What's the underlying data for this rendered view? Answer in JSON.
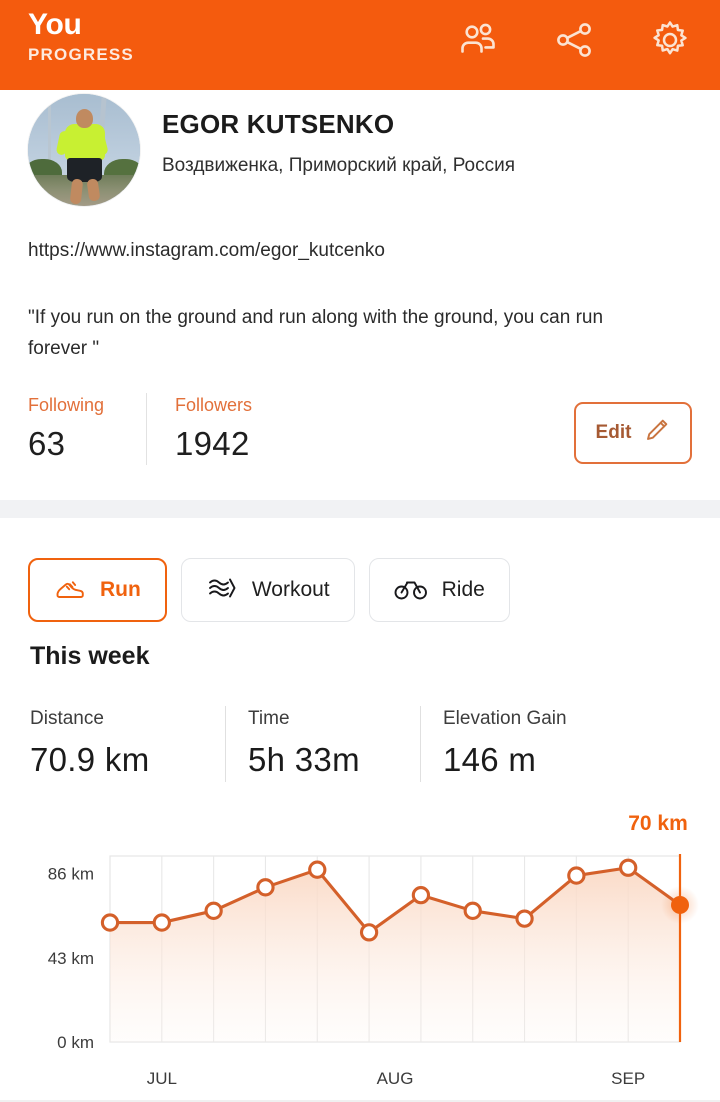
{
  "header": {
    "title": "You",
    "subtitle": "PROGRESS",
    "icons": [
      {
        "name": "friends-icon",
        "label": "Friends"
      },
      {
        "name": "share-icon",
        "label": "Share"
      },
      {
        "name": "settings-gear-icon",
        "label": "Settings"
      }
    ],
    "background_color": "#f45b0e"
  },
  "profile": {
    "avatar_alt": "runner-photo",
    "name": "EGOR KUTSENKO",
    "location": "Воздвиженка, Приморский край, Россия",
    "link": "https://www.instagram.com/egor_kutcenko",
    "bio": "\"If you run on the ground and run along with the ground, you can run forever \"",
    "following_label": "Following",
    "following_count": "63",
    "followers_label": "Followers",
    "followers_count": "1942",
    "edit_label": "Edit",
    "accent_color": "#e2703a"
  },
  "activity_tabs": [
    {
      "label": "Run",
      "icon": "running-shoe-icon",
      "selected": true
    },
    {
      "label": "Workout",
      "icon": "workout-waves-icon",
      "selected": false
    },
    {
      "label": "Ride",
      "icon": "bicycle-icon",
      "selected": false
    }
  ],
  "this_week": {
    "title": "This week",
    "stats": [
      {
        "label": "Distance",
        "value": "70.9 km"
      },
      {
        "label": "Time",
        "value": "5h 33m"
      },
      {
        "label": "Elevation Gain",
        "value": "146 m"
      }
    ]
  },
  "chart_data": {
    "type": "line",
    "title": "",
    "xlabel": "",
    "ylabel": "",
    "ylim": [
      0,
      95
    ],
    "yticks": [
      0,
      43,
      86
    ],
    "ytick_labels": [
      "0 km",
      "43 km",
      "86 km"
    ],
    "x_tick_labels": [
      "JUL",
      "AUG",
      "SEP"
    ],
    "x_tick_positions": [
      1,
      5.5,
      10
    ],
    "grid": true,
    "legend": null,
    "line_color": "#d4602a",
    "fill_color": "#fbe3d4",
    "marker_style": "open-circle",
    "x": [
      0,
      1,
      2,
      3,
      4,
      5,
      6,
      7,
      8,
      9,
      10,
      11
    ],
    "values": [
      61,
      61,
      67,
      79,
      88,
      56,
      75,
      67,
      63,
      85,
      89,
      70
    ],
    "highlight": {
      "index": 11,
      "value": 70,
      "label": "70 km",
      "color": "#f0620e",
      "style": "filled-dot-with-halo-and-vertical-line"
    }
  }
}
